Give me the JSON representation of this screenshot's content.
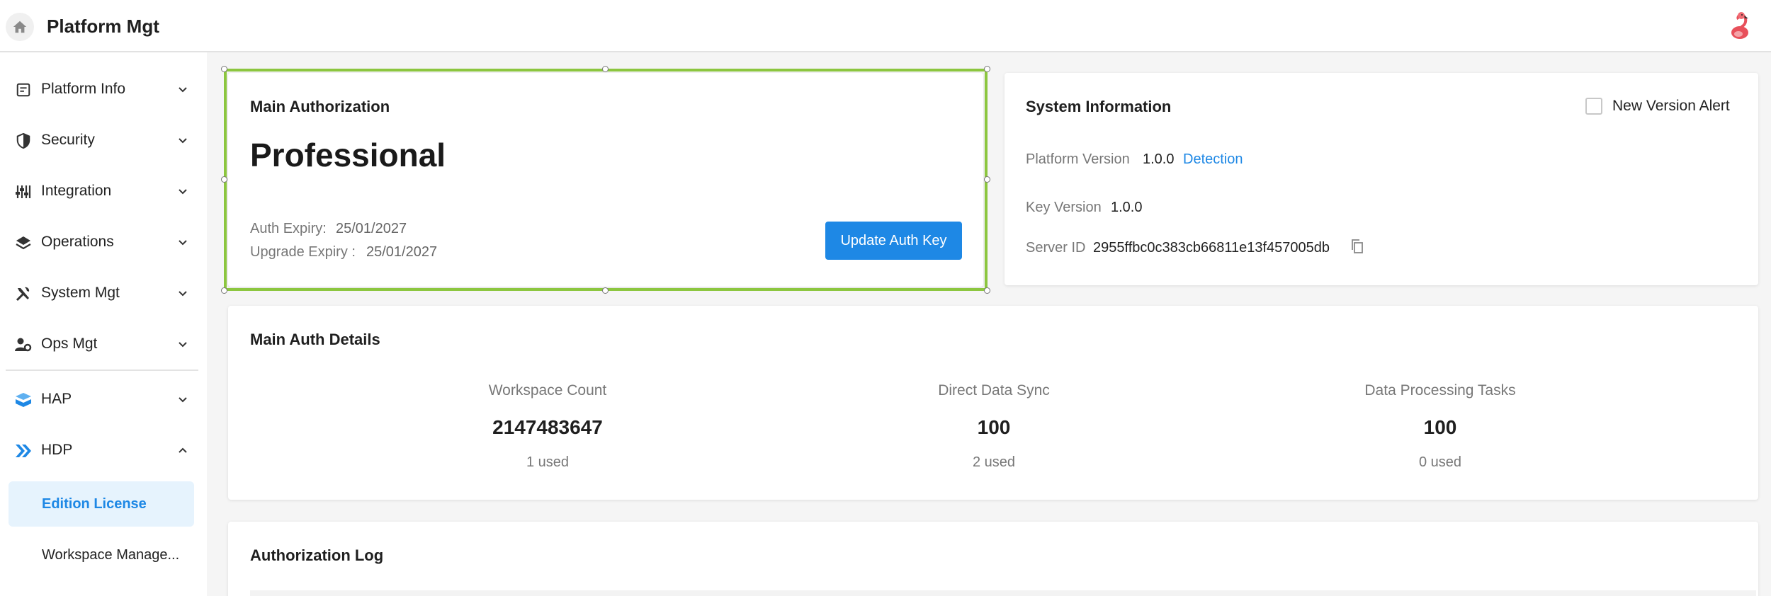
{
  "header": {
    "title": "Platform Mgt",
    "home_icon": "home-icon",
    "avatar_icon": "flamingo-avatar-icon"
  },
  "sidebar": {
    "items": [
      {
        "label": "Platform Info",
        "icon": "document-icon",
        "expanded": false
      },
      {
        "label": "Security",
        "icon": "shield-icon",
        "expanded": false
      },
      {
        "label": "Integration",
        "icon": "sliders-icon",
        "expanded": false
      },
      {
        "label": "Operations",
        "icon": "layers-icon",
        "expanded": false
      },
      {
        "label": "System Mgt",
        "icon": "tools-icon",
        "expanded": false
      },
      {
        "label": "Ops Mgt",
        "icon": "user-gear-icon",
        "expanded": false
      },
      {
        "label": "HAP",
        "icon": "hap-icon",
        "expanded": false
      },
      {
        "label": "HDP",
        "icon": "hdp-icon",
        "expanded": true
      }
    ],
    "sub_items": [
      {
        "label": "Edition License",
        "active": true
      },
      {
        "label": "Workspace Manage...",
        "active": false
      }
    ]
  },
  "main_authorization": {
    "title": "Main Authorization",
    "edition": "Professional",
    "auth_expiry_label": "Auth Expiry:",
    "auth_expiry_value": "25/01/2027",
    "upgrade_expiry_label": "Upgrade Expiry :",
    "upgrade_expiry_value": "25/01/2027",
    "update_button": "Update Auth Key"
  },
  "system_information": {
    "title": "System Information",
    "new_version_alert_label": "New Version Alert",
    "new_version_alert_checked": false,
    "platform_version_label": "Platform Version",
    "platform_version_value": "1.0.0",
    "detection_link": "Detection",
    "key_version_label": "Key Version",
    "key_version_value": "1.0.0",
    "server_id_label": "Server ID",
    "server_id_value": "2955ffbc0c383cb66811e13f457005db"
  },
  "main_auth_details": {
    "title": "Main Auth Details",
    "stats": [
      {
        "label": "Workspace Count",
        "value": "2147483647",
        "used": "1 used"
      },
      {
        "label": "Direct Data Sync",
        "value": "100",
        "used": "2 used"
      },
      {
        "label": "Data Processing Tasks",
        "value": "100",
        "used": "0 used"
      }
    ]
  },
  "authorization_log": {
    "title": "Authorization Log"
  },
  "colors": {
    "accent": "#1e88e5",
    "selection": "#8cc63f",
    "active_bg": "#e6f3fd"
  }
}
